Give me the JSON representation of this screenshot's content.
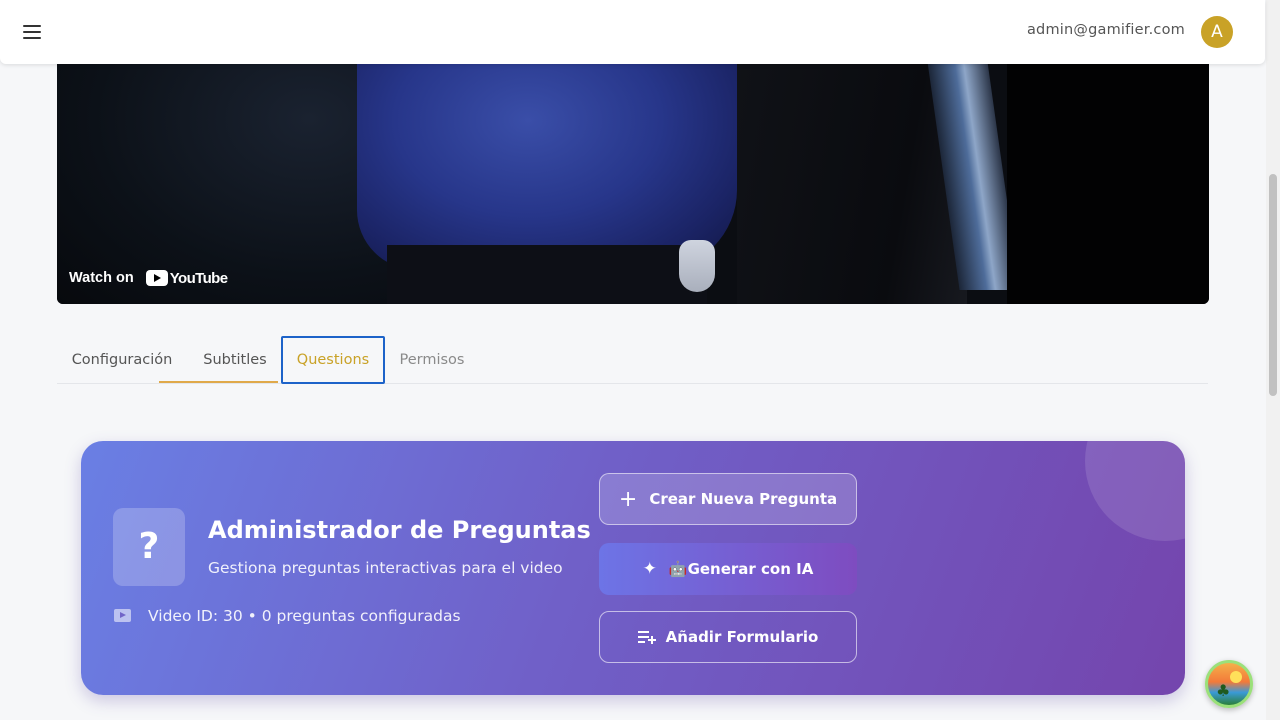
{
  "header": {
    "menu_icon": "menu-icon",
    "user_email": "admin@gamifier.com",
    "avatar_initial": "A",
    "avatar_color": "#c9a227"
  },
  "video": {
    "watch_on": "Watch on",
    "brand": "YouTube"
  },
  "tabs": [
    {
      "label": "Configuración"
    },
    {
      "label": "Subtitles"
    },
    {
      "label": "Questions"
    },
    {
      "label": "Permisos"
    }
  ],
  "panel": {
    "icon_glyph": "?",
    "title": "Administrador de Preguntas",
    "subtitle": "Gestiona preguntas interactivas para el video",
    "video_info": "Video ID: 30 • 0 preguntas configuradas",
    "buttons": {
      "create": {
        "icon": "+",
        "label": "Crear Nueva Pregunta"
      },
      "generate": {
        "icon": "✦",
        "label": "🤖Generar con IA"
      },
      "add_form": {
        "label": "Añadir Formulario"
      }
    },
    "gradient_start": "#6a7fe4",
    "gradient_end": "#7445ad"
  },
  "accent_colors": {
    "active_tab_text": "#c9a227",
    "tab_indicator": "#e0a94a",
    "focus_outline": "#1d63c9"
  }
}
